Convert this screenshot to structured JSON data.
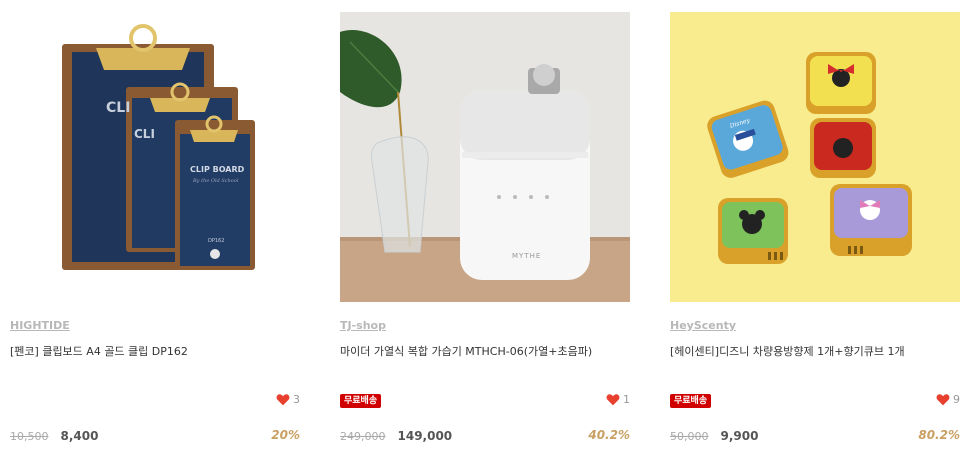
{
  "products": [
    {
      "seller": "HIGHTIDE",
      "name": "[펜코] 클립보드 A4 골드 클립 DP162",
      "likes": "3",
      "badge": "",
      "original_price": "10,500",
      "sale_price": "8,400",
      "discount": "20%",
      "image_text": {
        "clip_board": "CLIP BOARD",
        "tagline": "By the Old School",
        "model": "DP162",
        "small": "CLI"
      }
    },
    {
      "seller": "TJ-shop",
      "name": "마이더 가열식 복합 가습기 MTHCH-06(가열+초음파)",
      "likes": "1",
      "badge": "무료배송",
      "original_price": "249,000",
      "sale_price": "149,000",
      "discount": "40.2%",
      "image_text": {
        "brand": "MYTHE"
      }
    },
    {
      "seller": "HeyScenty",
      "name": "[헤이센티]디즈니 차량용방향제 1개+향기큐브 1개",
      "likes": "9",
      "badge": "무료배송",
      "original_price": "50,000",
      "sale_price": "9,900",
      "discount": "80.2%",
      "image_text": {
        "brand": "Disney"
      }
    }
  ],
  "colors": {
    "heart": "#e8402f",
    "badge": "#d10000",
    "discount": "#c9a063",
    "seller": "#b8b8b8"
  }
}
